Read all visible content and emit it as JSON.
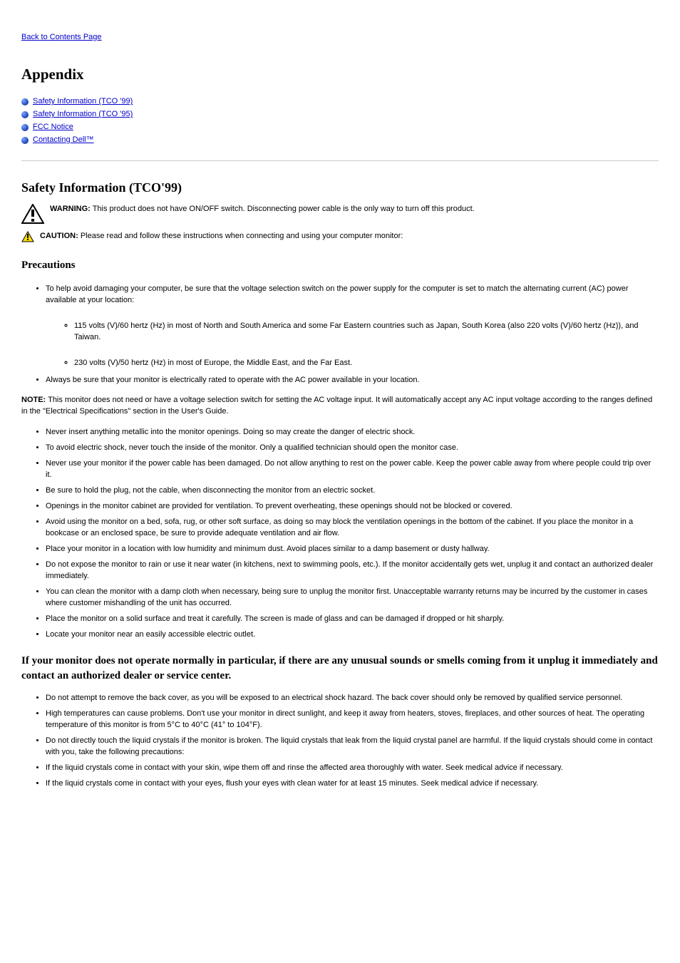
{
  "backLink": "Back to Contents Page",
  "pageTitle": "Appendix",
  "toc": [
    {
      "id": "safety",
      "label": "Safety Information (TCO '99)"
    },
    {
      "id": "safety95",
      "label": "Safety Information (TCO '95)"
    },
    {
      "id": "fcc",
      "label": "FCC Notice"
    },
    {
      "id": "contact",
      "label": "Contacting Dell™"
    }
  ],
  "section1Title": "Safety Information (TCO'99)",
  "warning": {
    "label": "WARNING:",
    "text": "This product does not have ON/OFF switch. Disconnecting power cable is the only way to turn off this product."
  },
  "caution": {
    "label": "CAUTION:",
    "text": "Please read and follow these instructions when connecting and using your computer monitor:"
  },
  "mainBullets": {
    "b1": {
      "intro": "To help avoid damaging your computer, be sure that the voltage selection switch on the power supply for the computer is set to match the alternating current (AC) power available at your location:",
      "sub1": "115 volts (V)/60 hertz (Hz) in most of North and South America and some Far Eastern countries such as Japan, South Korea (also 220 volts (V)/60 hertz (Hz)), and Taiwan.",
      "sub2": "230 volts (V)/50 hertz (Hz) in most of Europe, the Middle East, and the Far East."
    },
    "b2": "Always be sure that your monitor is electrically rated to operate with the AC power available in your location."
  },
  "note": {
    "label": "NOTE:",
    "text": "This monitor does not need or have a voltage selection switch for setting the AC voltage input. It will automatically accept any AC input voltage according to the ranges defined in the \"Electrical Specifications\" section in the User's Guide."
  },
  "bulletsA": [
    "Never insert anything metallic into the monitor openings. Doing so may create the danger of electric shock.",
    "To avoid electric shock, never touch the inside of the monitor. Only a qualified technician should open the monitor case.",
    "Never use your monitor if the power cable has been damaged. Do not allow anything to rest on the power cable. Keep the power cable away from where people could trip over it.",
    "Be sure to hold the plug, not the cable, when disconnecting the monitor from an electric socket.",
    "Openings in the monitor cabinet are provided for ventilation. To prevent overheating, these openings should not be blocked or covered.",
    "Avoid using the monitor on a bed, sofa, rug, or other soft surface, as doing so may block the ventilation openings in the bottom of the cabinet. If you place the monitor in a bookcase or an enclosed space, be sure to provide adequate ventilation and air flow.",
    "Place your monitor in a location with low humidity and minimum dust. Avoid places similar to a damp basement or dusty hallway.",
    "Do not expose the monitor to rain or use it near water (in kitchens, next to swimming pools, etc.). If the monitor accidentally gets wet, unplug it and contact an authorized dealer immediately.",
    "You can clean the monitor with a damp cloth when necessary, being sure to unplug the monitor first. Unacceptable warranty returns may be incurred by the customer in cases where customer mishandling of the unit has occurred.",
    "Place the monitor on a solid surface and treat it carefully. The screen is made of glass and can be damaged if dropped or hit sharply.",
    "Locate your monitor near an easily accessible electric outlet."
  ],
  "subhead1": "If your monitor does not operate normally in particular, if there are any unusual sounds or smells coming from it unplug it immediately and contact an authorized dealer or service center.",
  "bulletsB": [
    "Do not attempt to remove the back cover, as you will be exposed to an electrical shock hazard. The back cover should only be removed by qualified service personnel.",
    "High temperatures can cause problems. Don't use your monitor in direct sunlight, and keep it away from heaters, stoves, fireplaces, and other sources of heat. The operating temperature of this monitor is from 5°C to 40°C (41° to 104°F).",
    "Do not directly touch the liquid crystals if the monitor is broken. The liquid crystals that leak from the liquid crystal panel are harmful. If the liquid crystals should come in contact with you, take the following precautions:",
    "If the liquid crystals come in contact with your skin, wipe them off and rinse the affected area thoroughly with water. Seek medical advice if necessary.",
    "If the liquid crystals come in contact with your eyes, flush your eyes with clean water for at least 15 minutes. Seek medical advice if necessary."
  ]
}
